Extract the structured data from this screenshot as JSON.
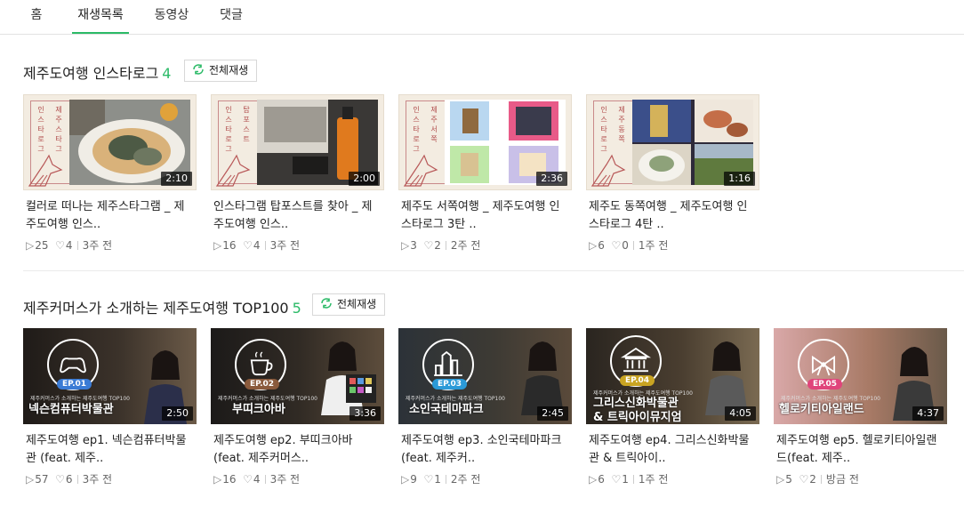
{
  "tabs": [
    {
      "label": "홈"
    },
    {
      "label": "재생목록"
    },
    {
      "label": "동영상"
    },
    {
      "label": "댓글"
    }
  ],
  "active_tab": "재생목록",
  "accent_color": "#2bba67",
  "play_all_label": "전체재생",
  "sections": [
    {
      "title": "제주도여행 인스타로그",
      "count": "4",
      "videos": [
        {
          "title": "컬러로 떠나는 제주스타그램 _ 제주도여행 인스..",
          "duration": "2:10",
          "plays": "25",
          "likes": "4",
          "ago": "3주 전",
          "scroll_text": [
            "인스타로그",
            "제주스타그"
          ]
        },
        {
          "title": "인스타그램 탑포스트를 찾아 _ 제주도여행 인스..",
          "duration": "2:00",
          "plays": "16",
          "likes": "4",
          "ago": "3주 전",
          "scroll_text": [
            "인스타로그",
            "탑포스트"
          ]
        },
        {
          "title": "제주도 서쪽여행 _ 제주도여행 인스타로그 3탄 ..",
          "duration": "2:36",
          "plays": "3",
          "likes": "2",
          "ago": "2주 전",
          "scroll_text": [
            "인스타로그",
            "제주서쪽"
          ]
        },
        {
          "title": "제주도 동쪽여행 _ 제주도여행 인스타로그 4탄 ..",
          "duration": "1:16",
          "plays": "6",
          "likes": "0",
          "ago": "1주 전",
          "scroll_text": [
            "인스타로그",
            "제주동쪽"
          ]
        }
      ]
    },
    {
      "title": "제주커머스가 소개하는 제주도여행 TOP100",
      "count": "5",
      "videos": [
        {
          "title": "제주도여행 ep1. 넥슨컴퓨터박물관 (feat. 제주..",
          "duration": "2:50",
          "plays": "57",
          "likes": "6",
          "ago": "3주 전",
          "ep": "EP.01",
          "name": "넥슨컴퓨터박물관",
          "badge_color": "#3a7bd5",
          "icon": "gamepad-icon"
        },
        {
          "title": "제주도여행 ep2. 부띠크아바 (feat. 제주커머스..",
          "duration": "3:36",
          "plays": "16",
          "likes": "4",
          "ago": "3주 전",
          "ep": "EP.02",
          "name": "부띠크아바",
          "badge_color": "#8a5a3c",
          "icon": "coffee-icon"
        },
        {
          "title": "제주도여행 ep3. 소인국테마파크 (feat. 제주커..",
          "duration": "2:45",
          "plays": "9",
          "likes": "1",
          "ago": "2주 전",
          "ep": "EP.03",
          "name": "소인국테마파크",
          "badge_color": "#2b9ad8",
          "icon": "city-icon"
        },
        {
          "title": "제주도여행 ep4. 그리스신화박물관 & 트릭아이..",
          "duration": "4:05",
          "plays": "6",
          "likes": "1",
          "ago": "1주 전",
          "ep": "EP.04",
          "name": "그리스신화박물관\n& 트릭아이뮤지엄",
          "name_1": "그리스신화박물관",
          "name_2": "& 트릭아이뮤지엄",
          "badge_color": "#c9a422",
          "icon": "museum-icon"
        },
        {
          "title": "제주도여행 ep5. 헬로키티아일랜드(feat. 제주..",
          "duration": "4:37",
          "plays": "5",
          "likes": "2",
          "ago": "방금 전",
          "ep": "EP.05",
          "name": "헬로키티아일랜드",
          "badge_color": "#e0457b",
          "icon": "ribbon-icon"
        }
      ],
      "ep_subtitle": "제주커머스가 소개하는 제주도여행 TOP100"
    }
  ]
}
